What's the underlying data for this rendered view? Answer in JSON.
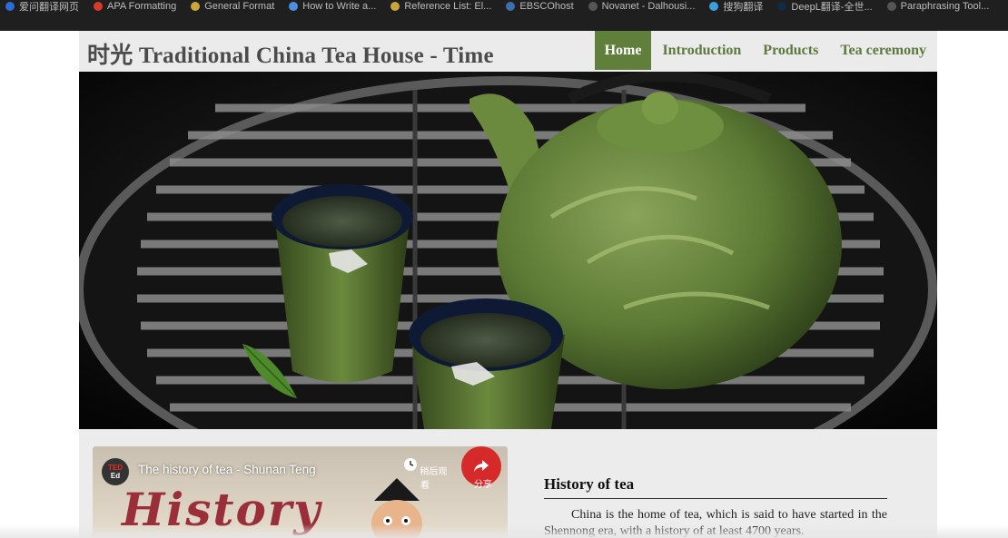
{
  "browser": {
    "bookmarks": [
      {
        "label": "爱问翻译网页",
        "color": "#2b6cd9"
      },
      {
        "label": "APA Formatting",
        "color": "#d83a2a"
      },
      {
        "label": "General Format",
        "color": "#c8a63a"
      },
      {
        "label": "How to Write a...",
        "color": "#4a90e2"
      },
      {
        "label": "Reference List: El...",
        "color": "#c8a63a"
      },
      {
        "label": "EBSCOhost",
        "color": "#3a6fb0"
      },
      {
        "label": "Novanet - Dalhousi...",
        "color": "#555555"
      },
      {
        "label": "搜狗翻译",
        "color": "#3aa0e0"
      },
      {
        "label": "DeepL翻译-全世...",
        "color": "#0f2b46"
      },
      {
        "label": "Paraphrasing Tool...",
        "color": "#555555"
      }
    ]
  },
  "site": {
    "title": "时光 Traditional China Tea House - Time",
    "nav": [
      {
        "label": "Home",
        "active": true
      },
      {
        "label": "Introduction",
        "active": false
      },
      {
        "label": "Products",
        "active": false
      },
      {
        "label": "Tea ceremony",
        "active": false
      }
    ],
    "accent_color": "#5f7f3b"
  },
  "video": {
    "channel_badge_top": "TED",
    "channel_badge_bottom": "Ed",
    "title": "The history of tea - Shunan Teng",
    "thumbnail_text": "History",
    "watch_later_label": "稍后观看",
    "share_label": "分享"
  },
  "article": {
    "heading": "History of tea",
    "paragraph": "China is the home of tea, which is said to have started in the Shennong era, with a history of at least 4700 years."
  }
}
